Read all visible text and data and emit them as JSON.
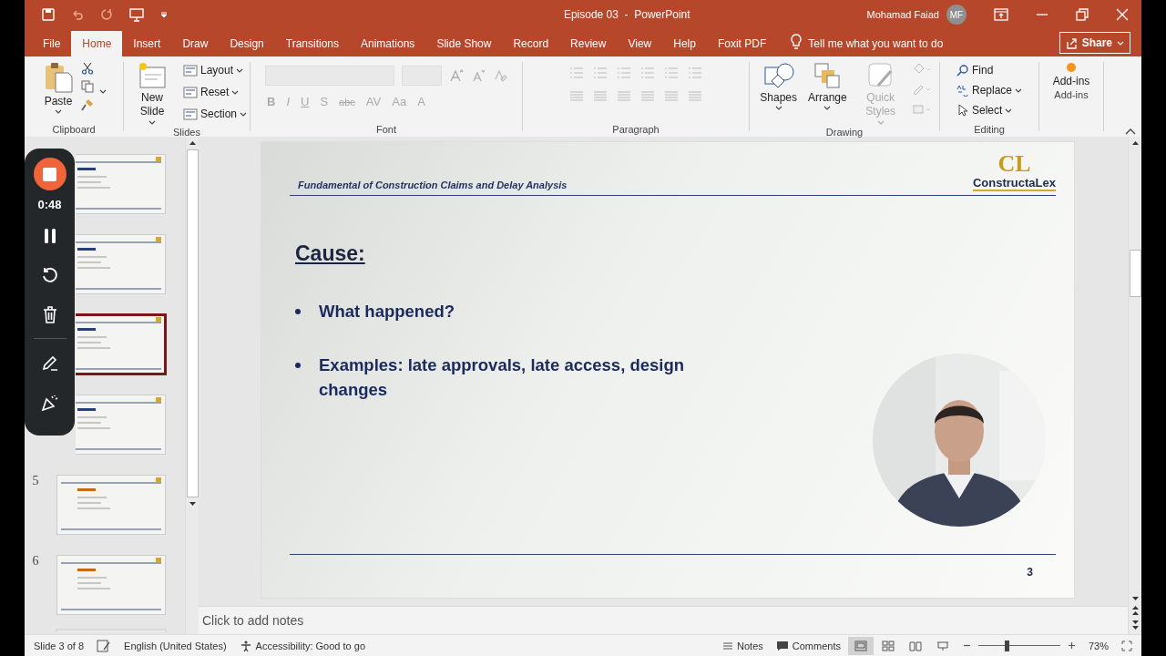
{
  "window": {
    "title": "Episode 03  -  PowerPoint",
    "user": "Mohamad Faiad",
    "initials": "MF"
  },
  "menu_tabs": [
    {
      "label": "File",
      "selected": false
    },
    {
      "label": "Home",
      "selected": true
    },
    {
      "label": "Insert",
      "selected": false
    },
    {
      "label": "Draw",
      "selected": false
    },
    {
      "label": "Design",
      "selected": false
    },
    {
      "label": "Transitions",
      "selected": false
    },
    {
      "label": "Animations",
      "selected": false
    },
    {
      "label": "Slide Show",
      "selected": false
    },
    {
      "label": "Record",
      "selected": false
    },
    {
      "label": "Review",
      "selected": false
    },
    {
      "label": "View",
      "selected": false
    },
    {
      "label": "Help",
      "selected": false
    },
    {
      "label": "Foxit PDF",
      "selected": false
    }
  ],
  "tell_me": {
    "placeholder": "Tell me what you want to do"
  },
  "share_button": "Share",
  "ribbon": {
    "paste": "Paste",
    "clipboard": "Clipboard",
    "new_slide": "New Slide",
    "slide_items": [
      "Layout",
      "Reset",
      "Section"
    ],
    "slides": "Slides",
    "font_buttons": [
      "B",
      "I",
      "U",
      "S",
      "abc",
      "AV",
      "Aa",
      "A"
    ],
    "font": "Font",
    "paragraph": "Paragraph",
    "shapes": "Shapes",
    "arrange": "Arrange",
    "quick_styles": {
      "label": "Quick Styles",
      "disabled": true
    },
    "drawing": "Drawing",
    "editing_items": [
      "Find",
      "Replace",
      "Select"
    ],
    "editing": "Editing",
    "add_ins_button": "Add-ins",
    "add_ins": "Add-ins"
  },
  "recorder": {
    "time": "0:48"
  },
  "thumbnails": [
    {
      "selected": false
    },
    {
      "selected": false
    },
    {
      "selected": true
    },
    {
      "selected": false
    },
    {
      "number": "5",
      "selected": false
    },
    {
      "number": "6",
      "selected": false
    }
  ],
  "slide": {
    "header": "Fundamental of Construction Claims and Delay Analysis",
    "logo_mark": "CL",
    "logo_name": "ConstructaLex",
    "title": "Cause:",
    "bullets": [
      "What happened?",
      "Examples: late approvals, late access, design changes"
    ],
    "page": "3"
  },
  "notes": {
    "placeholder": "Click to add notes"
  },
  "status_bar": {
    "slide": "Slide 3 of 8",
    "language": "English (United States)",
    "accessibility": "Accessibility: Good to go",
    "notes": "Notes",
    "comments": "Comments",
    "views": [
      {
        "selected": true
      },
      {
        "selected": false
      },
      {
        "selected": false
      },
      {
        "selected": false
      }
    ],
    "zoom": {
      "level": 0.35,
      "reading": "73%"
    }
  }
}
